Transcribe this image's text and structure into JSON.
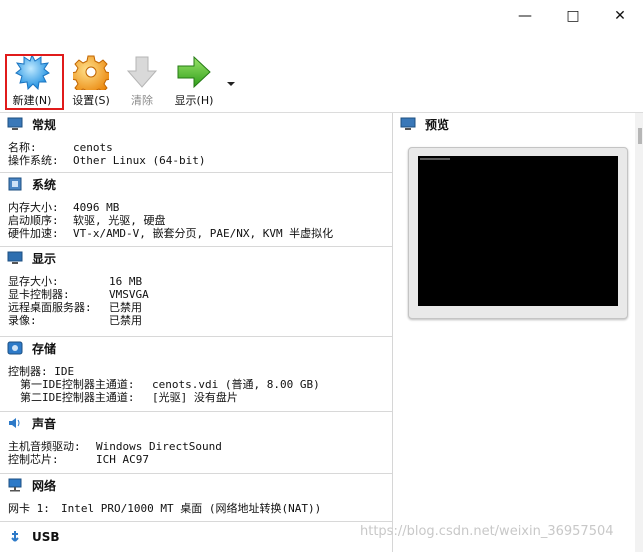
{
  "toolbar": {
    "new_label": "新建(N)",
    "settings_label": "设置(S)",
    "clear_label": "清除",
    "show_label": "显示(H)"
  },
  "sections": {
    "general": {
      "title": "常规",
      "rows": [
        {
          "key": "名称:",
          "value": "cenots"
        },
        {
          "key": "操作系统:",
          "value": "Other Linux (64-bit)"
        }
      ]
    },
    "system": {
      "title": "系统",
      "rows": [
        {
          "key": "内存大小:",
          "value": "4096 MB"
        },
        {
          "key": "启动顺序:",
          "value": "软驱, 光驱, 硬盘"
        },
        {
          "key": "硬件加速:",
          "value": "VT-x/AMD-V, 嵌套分页, PAE/NX, KVM 半虚拟化"
        }
      ]
    },
    "display": {
      "title": "显示",
      "rows": [
        {
          "key": "显存大小:",
          "value": "16 MB"
        },
        {
          "key": "显卡控制器:",
          "value": "VMSVGA"
        },
        {
          "key": "远程桌面服务器:",
          "value": "已禁用"
        },
        {
          "key": "录像:",
          "value": "已禁用"
        }
      ]
    },
    "storage": {
      "title": "存储",
      "rows": [
        {
          "key": "控制器: IDE",
          "value": ""
        },
        {
          "key": "第一IDE控制器主通道:",
          "value": "cenots.vdi (普通, 8.00 GB)"
        },
        {
          "key": "第二IDE控制器主通道:",
          "value": "[光驱] 没有盘片"
        }
      ]
    },
    "audio": {
      "title": "声音",
      "rows": [
        {
          "key": "主机音频驱动:",
          "value": "Windows DirectSound"
        },
        {
          "key": "控制芯片:",
          "value": "ICH AC97"
        }
      ]
    },
    "network": {
      "title": "网络",
      "rows": [
        {
          "key": "网卡 1:",
          "value": "Intel PRO/1000 MT 桌面 (网络地址转换(NAT))"
        }
      ]
    },
    "usb": {
      "title": "USB"
    }
  },
  "preview": {
    "title": "预览"
  },
  "watermark": "https://blog.csdn.net/weixin_36957504"
}
